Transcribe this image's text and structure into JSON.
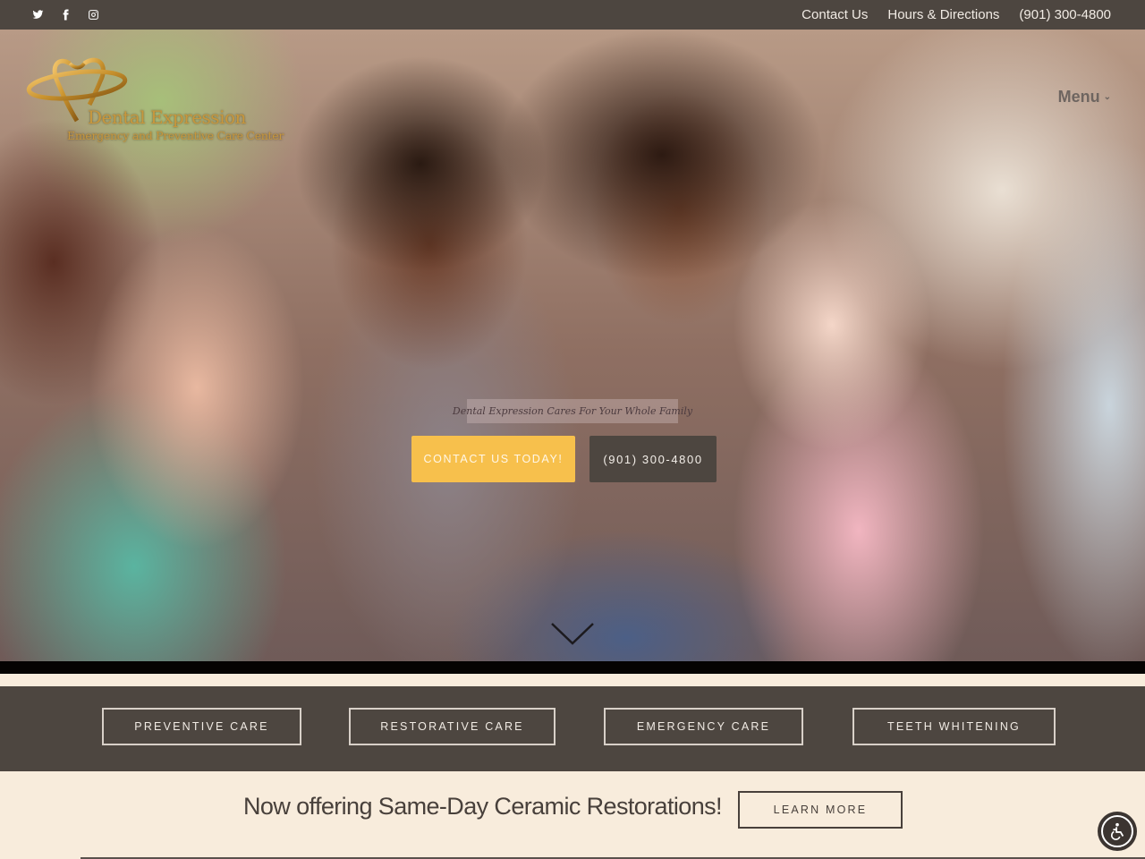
{
  "topbar": {
    "social": [
      {
        "name": "twitter",
        "icon": "twitter-icon"
      },
      {
        "name": "facebook",
        "icon": "facebook-icon"
      },
      {
        "name": "instagram",
        "icon": "instagram-icon"
      }
    ],
    "links": [
      "Contact Us",
      "Hours & Directions",
      "(901) 300-4800"
    ]
  },
  "logo": {
    "name": "Dental Expression",
    "tagline": "Emergency and Preventive Care Center"
  },
  "nav": {
    "menu_label": "Menu",
    "menu_icon": "chevron-down-icon"
  },
  "hero": {
    "tagline": "Dental Expression Cares For Your Whole Family",
    "cta_primary": "CONTACT US TODAY!",
    "cta_phone": "(901) 300-4800",
    "scroll_icon": "chevron-down-icon"
  },
  "services": [
    "PREVENTIVE CARE",
    "RESTORATIVE CARE",
    "EMERGENCY CARE",
    "TEETH WHITENING"
  ],
  "promo": {
    "text": "Now offering Same-Day Ceramic Restorations!",
    "button": "LEARN MORE"
  },
  "accessibility": {
    "icon": "wheelchair-icon"
  },
  "colors": {
    "bar_brown": "#4d4640",
    "accent_yellow": "#f7c04c",
    "cream": "#f8ecdc",
    "logo_gold": "#c7973d"
  }
}
